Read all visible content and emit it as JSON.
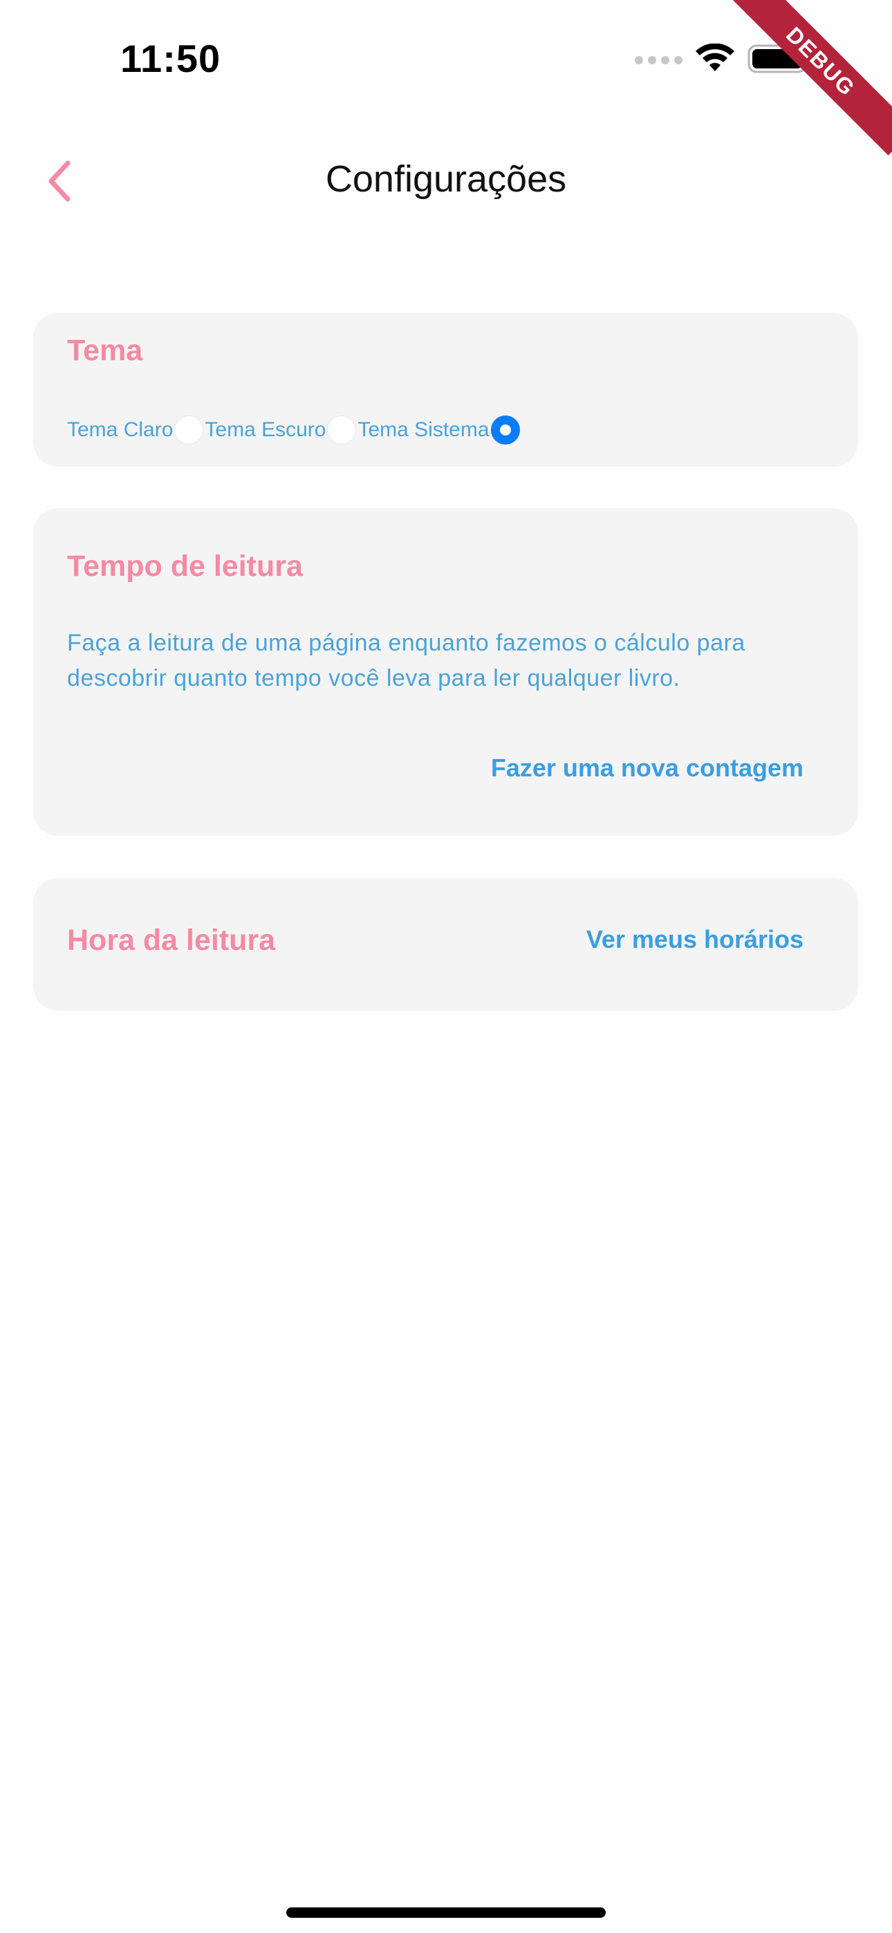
{
  "status_bar": {
    "time": "11:50",
    "icons": [
      "signal-dots-icon",
      "wifi-icon",
      "battery-icon"
    ]
  },
  "debug_banner": "DEBUG",
  "nav": {
    "back_icon": "chevron-left-icon",
    "title": "Configurações"
  },
  "colors": {
    "accent_pink": "#f48aa3",
    "text_blue": "#4aa3d8",
    "link_blue": "#3a9ee0",
    "radio_selected": "#0a7cf7",
    "card_bg": "#f4f4f5"
  },
  "theme_card": {
    "title": "Tema",
    "options": [
      {
        "label": "Tema Claro",
        "selected": false
      },
      {
        "label": "Tema Escuro",
        "selected": false
      },
      {
        "label": "Tema Sistema",
        "selected": true
      }
    ]
  },
  "reading_time_card": {
    "title": "Tempo de leitura",
    "description": "Faça a leitura de uma página enquanto fazemos o cálculo para descobrir quanto tempo você leva para ler qualquer livro.",
    "action_label": "Fazer uma nova contagem"
  },
  "reading_hour_card": {
    "title": "Hora da leitura",
    "action_label": "Ver meus horários"
  }
}
